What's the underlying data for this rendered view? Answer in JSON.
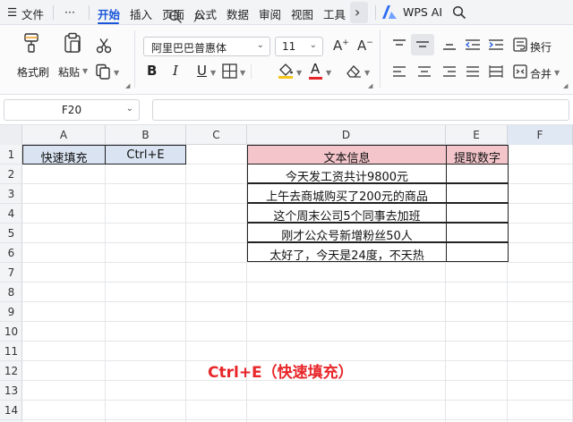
{
  "menubar": {
    "menu_icon": "☰",
    "file": "文件",
    "more": "···",
    "tabs": [
      "开始",
      "插入",
      "页面",
      "公式",
      "数据",
      "审阅",
      "视图",
      "工具"
    ],
    "more_arrow": "›",
    "wps_ai": "WPS AI"
  },
  "ribbon": {
    "format_painter": "格式刷",
    "paste": "粘贴",
    "font_name": "阿里巴巴普惠体",
    "font_size": "11",
    "bold": "B",
    "italic": "I",
    "underline": "U",
    "font_color_letter": "A",
    "wrap_text": "换行",
    "merge": "合并",
    "colors": {
      "fill": "#f5c518",
      "font": "#e8262a"
    }
  },
  "formula_bar": {
    "name_box": "F20",
    "fx": "fx",
    "formula": ""
  },
  "grid": {
    "columns": [
      "A",
      "B",
      "C",
      "D",
      "E",
      "F"
    ],
    "selected_column": "F",
    "rows": [
      "1",
      "2",
      "3",
      "4",
      "5",
      "6",
      "7",
      "8",
      "9",
      "10",
      "11",
      "12",
      "13",
      "14"
    ],
    "a1": "快速填充",
    "b1": "Ctrl+E",
    "d1": "文本信息",
    "e1": "提取数字",
    "d_values": [
      "今天发工资共计9800元",
      "上午去商城购买了200元的商品",
      "这个周末公司5个同事去加班",
      "刚才公众号新增粉丝50人",
      "太好了，今天是24度，不天热"
    ],
    "e_values": [
      "",
      "",
      "",
      "",
      ""
    ],
    "caption": "Ctrl+E（快速填充）"
  }
}
